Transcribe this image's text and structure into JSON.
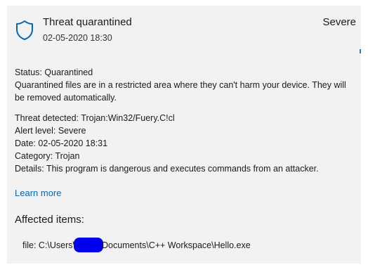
{
  "header": {
    "title": "Threat quarantined",
    "timestamp": "02-05-2020 18:30",
    "severity": "Severe",
    "icon": "shield-icon"
  },
  "status": {
    "label": "Status:",
    "value": "Quarantined",
    "description": "Quarantined files are in a restricted area where they can't harm your device. They will be removed automatically."
  },
  "details": {
    "threat_label": "Threat detected:",
    "threat_value": "Trojan:Win32/Fuery.C!cl",
    "alert_label": "Alert level:",
    "alert_value": "Severe",
    "date_label": "Date:",
    "date_value": "02-05-2020 18:31",
    "category_label": "Category:",
    "category_value": "Trojan",
    "details_label": "Details:",
    "details_value": "This program is dangerous and executes commands from an attacker."
  },
  "links": {
    "learn_more": "Learn more"
  },
  "affected": {
    "title": "Affected items:",
    "file_prefix": "file: C:\\Users\\",
    "file_suffix": "Documents\\C++ Workspace\\Hello.exe"
  },
  "colors": {
    "accent": "#0067b8",
    "redaction": "#0000ee",
    "panel": "#f2f2f2"
  }
}
